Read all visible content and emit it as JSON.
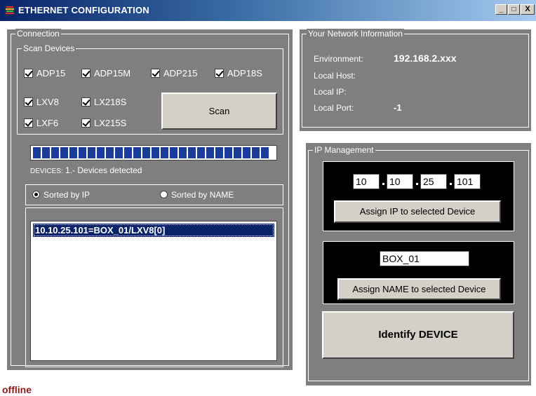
{
  "window": {
    "title": "ETHERNET CONFIGURATION",
    "controls": {
      "minimize": "_",
      "maximize": "□",
      "close": "X"
    }
  },
  "connection": {
    "legend": "Connection",
    "scan_devices": {
      "legend": "Scan Devices",
      "checkboxes": [
        {
          "label": "ADP15",
          "checked": true
        },
        {
          "label": "ADP15M",
          "checked": true
        },
        {
          "label": "ADP215",
          "checked": true
        },
        {
          "label": "ADP18S",
          "checked": true
        },
        {
          "label": "LXV8",
          "checked": true
        },
        {
          "label": "LX218S",
          "checked": true
        },
        {
          "label": "LXF6",
          "checked": true
        },
        {
          "label": "LX215S",
          "checked": true
        }
      ],
      "scan_button": "Scan"
    },
    "progress_fraction": 1.0,
    "devices_label": "DEVICES:",
    "devices_status": "1.- Devices detected",
    "sort_options": [
      {
        "label": "Sorted by IP",
        "selected": true
      },
      {
        "label": "Sorted by NAME",
        "selected": false
      }
    ],
    "device_list": [
      {
        "text": "10.10.25.101=BOX_01/LXV8[0]",
        "selected": true
      }
    ]
  },
  "network_info": {
    "legend": "Your Network Information",
    "rows": [
      {
        "label": "Environment:",
        "value": "192.168.2.xxx"
      },
      {
        "label": "Local Host:",
        "value": ""
      },
      {
        "label": "Local IP:",
        "value": ""
      },
      {
        "label": "Local Port:",
        "value": "-1"
      }
    ]
  },
  "ip_management": {
    "legend": "IP Management",
    "ip_octets": [
      "10",
      "10",
      "25",
      "101"
    ],
    "assign_ip_button": "Assign IP to selected Device",
    "device_name": "BOX_01",
    "assign_name_button": "Assign NAME to selected Device",
    "identify_button": "Identify DEVICE"
  },
  "status": {
    "text": "offline"
  },
  "colors": {
    "panel_gray": "#7f7f7f",
    "progress_blue": "#1a3d9c",
    "selection_blue": "#0a246a",
    "status_red": "#8b1a1a"
  }
}
